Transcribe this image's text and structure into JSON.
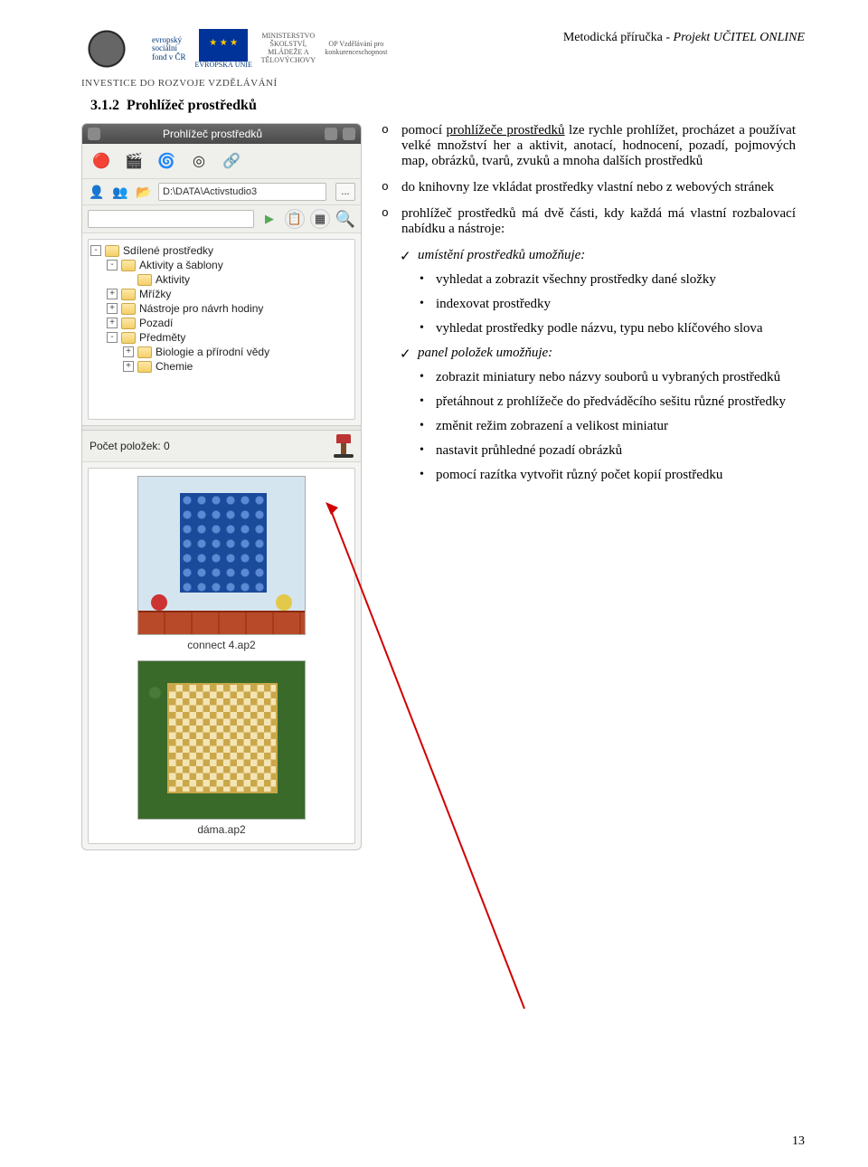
{
  "header": {
    "doc_title_plain": "Metodická příručka - ",
    "doc_title_italic": "Projekt UČITEL ONLINE",
    "invest": "INVESTICE DO ROZVOJE VZDĚLÁVÁNÍ",
    "esf_line1": "evropský",
    "esf_line2": "sociální",
    "esf_line3": "fond v ČR",
    "eu_label": "EVROPSKÁ UNIE",
    "msmt": "MINISTERSTVO ŠKOLSTVÍ, MLÁDEŽE A TĚLOVÝCHOVY",
    "opvk": "OP Vzdělávání pro konkurenceschopnost"
  },
  "section": {
    "number": "3.1.2",
    "title": "Prohlížeč prostředků"
  },
  "panel": {
    "title": "Prohlížeč prostředků",
    "path": "D:\\DATA\\Activstudio3",
    "tree": [
      {
        "label": "Sdílené prostředky",
        "expander": "-",
        "indent": 0
      },
      {
        "label": "Aktivity a šablony",
        "expander": "-",
        "indent": 1
      },
      {
        "label": "Aktivity",
        "expander": "",
        "indent": 2
      },
      {
        "label": "Mřížky",
        "expander": "+",
        "indent": 1
      },
      {
        "label": "Nástroje pro návrh hodiny",
        "expander": "+",
        "indent": 1
      },
      {
        "label": "Pozadí",
        "expander": "+",
        "indent": 1
      },
      {
        "label": "Předměty",
        "expander": "-",
        "indent": 1
      },
      {
        "label": "Biologie a přírodní vědy",
        "expander": "+",
        "indent": 2
      },
      {
        "label": "Chemie",
        "expander": "+",
        "indent": 2
      }
    ],
    "count_label": "Počet položek: 0",
    "thumbs": [
      {
        "caption": "connect 4.ap2"
      },
      {
        "caption": "dáma.ap2"
      }
    ]
  },
  "text": {
    "o1": "pomocí prohlížeče prostředků lze rychle prohlížet, procházet a používat velké množství her a aktivit, anotací, hodnocení, pozadí, pojmových map, obrázků, tvarů, zvuků a mnoha dalších prostředků",
    "o1_underline": "prohlížeče prostředků",
    "o2": "do knihovny lze vkládat prostředky vlastní nebo z webových stránek",
    "o3_a": "prohlížeč prostředků má dvě části, kdy každá má vlastní rozbalovací nabídku a nástroje:",
    "c1": "umístění prostředků umožňuje:",
    "d1": "vyhledat a zobrazit všechny prostředky dané složky",
    "d2": "indexovat prostředky",
    "d3": "vyhledat prostředky podle názvu, typu nebo klíčového slova",
    "c2": "panel položek umožňuje:",
    "d4": "zobrazit miniatury nebo názvy souborů u vybraných prostředků",
    "d5": "přetáhnout z prohlížeče do předváděcího sešitu různé prostředky",
    "d6": "změnit režim zobrazení a velikost miniatur",
    "d7": "nastavit průhledné pozadí obrázků",
    "d8": "pomocí razítka vytvořit různý počet kopií prostředku"
  },
  "page_number": "13"
}
